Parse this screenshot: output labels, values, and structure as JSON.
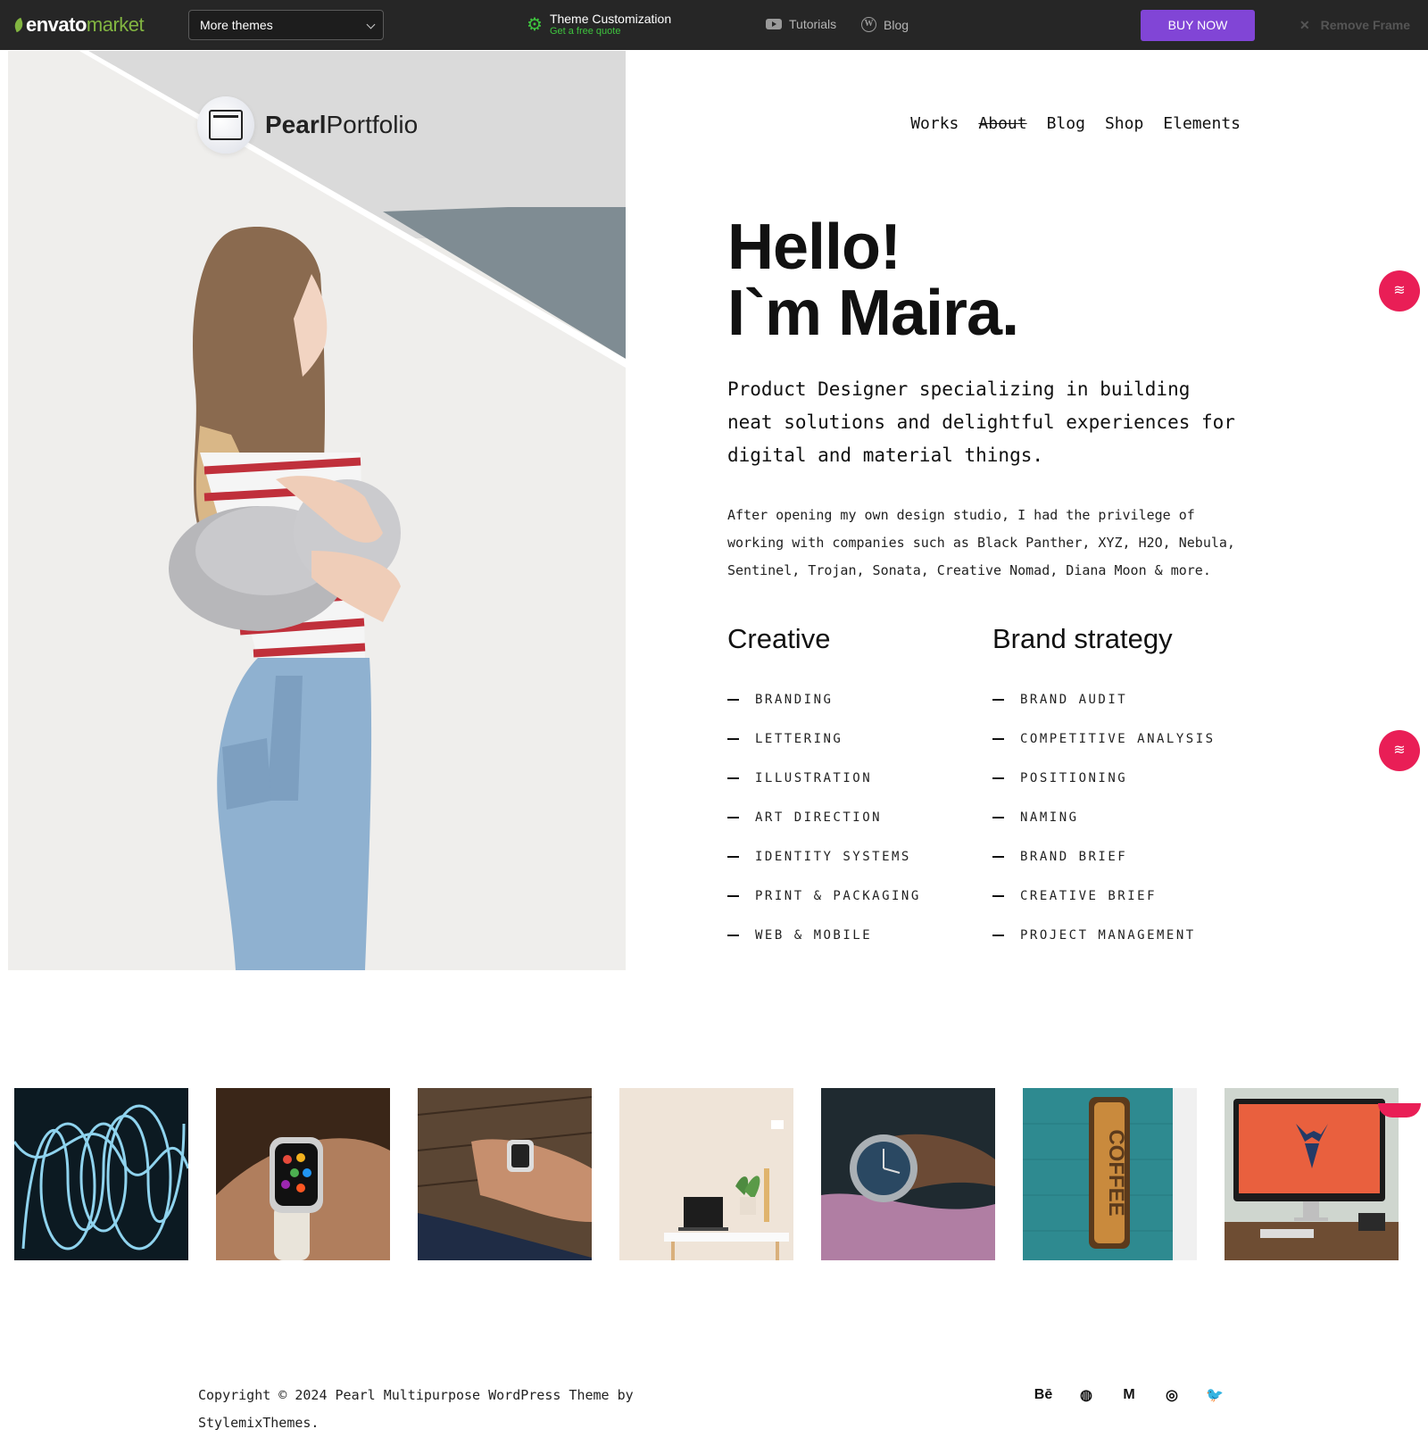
{
  "envato_bar": {
    "logo_brand": "envato",
    "logo_market": "market",
    "themes_select": "More themes",
    "customization_title": "Theme Customization",
    "customization_sub": "Get a free quote",
    "tutorials": "Tutorials",
    "blog": "Blog",
    "buy_now": "BUY NOW",
    "remove_frame": "Remove Frame",
    "accent_color": "#8145d6",
    "green_color": "#3ec43e"
  },
  "site": {
    "logo_bold": "Pearl",
    "logo_light": "Portfolio",
    "nav": [
      "Works",
      "About",
      "Blog",
      "Shop",
      "Elements"
    ],
    "active_nav": "About"
  },
  "intro": {
    "hello_line1": "Hello!",
    "hello_line2": "I`m Maira.",
    "lead": "Product Designer specializing in building neat solutions and delightful experiences for digital and material things.",
    "paragraph": "After opening my own design studio, I had the privilege of working with companies such as Black Panther, XYZ, H2O, Nebula, Sentinel, Trojan, Sonata, Creative Nomad, Diana Moon & more."
  },
  "skills": {
    "creative": {
      "title": "Creative",
      "items": [
        "BRANDING",
        "LETTERING",
        "ILLUSTRATION",
        "ART DIRECTION",
        "IDENTITY SYSTEMS",
        "PRINT & PACKAGING",
        "WEB & MOBILE"
      ]
    },
    "brand": {
      "title": "Brand strategy",
      "items": [
        "BRAND AUDIT",
        "COMPETITIVE ANALYSIS",
        "POSITIONING",
        "NAMING",
        "BRAND BRIEF",
        "CREATIVE BRIEF",
        "PROJECT MANAGEMENT"
      ]
    }
  },
  "gallery": [
    {
      "icon": "neon-wires-image"
    },
    {
      "icon": "smartwatch-wrist-image"
    },
    {
      "icon": "watch-on-table-image"
    },
    {
      "icon": "desk-laptop-image"
    },
    {
      "icon": "wristwatch-closeup-image"
    },
    {
      "icon": "coffee-sign-image",
      "text": "COFFEE"
    },
    {
      "icon": "imac-deer-image"
    }
  ],
  "footer": {
    "copyright": "Copyright © 2024 Pearl Multipurpose WordPress Theme by StylemixThemes.",
    "social": [
      {
        "name": "behance-icon",
        "glyph": "Bē"
      },
      {
        "name": "dribbble-icon",
        "glyph": "◍"
      },
      {
        "name": "medium-icon",
        "glyph": "M"
      },
      {
        "name": "instagram-icon",
        "glyph": "◎"
      },
      {
        "name": "twitter-icon",
        "glyph": "🐦"
      }
    ]
  },
  "accent_color": "#e91e56"
}
